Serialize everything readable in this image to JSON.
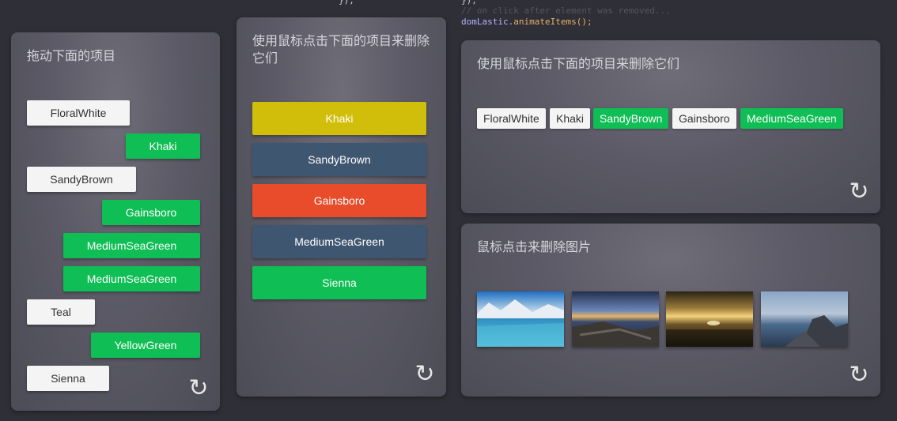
{
  "code": {
    "line_top": "});",
    "line_top_left": "});",
    "line_comment": "// on click after element was removed...",
    "line_call_obj": "domLastic.",
    "line_call_method": "animateItems();"
  },
  "panel1": {
    "title": "拖动下面的项目",
    "items": [
      "FloralWhite",
      "Khaki",
      "SandyBrown",
      "Gainsboro",
      "MediumSeaGreen",
      "MediumSeaGreen",
      "Teal",
      "YellowGreen",
      "Sienna"
    ]
  },
  "panel2": {
    "title": "使用鼠标点击下面的项目来删除它们",
    "items": [
      "Khaki",
      "SandyBrown",
      "Gainsboro",
      "MediumSeaGreen",
      "Sienna"
    ],
    "colors": [
      "#d1be0a",
      "#3f5670",
      "#e84c2b",
      "#3f5670",
      "#0fbe54"
    ]
  },
  "panel3": {
    "title": "使用鼠标点击下面的项目来删除它们",
    "tags": [
      "FloralWhite",
      "Khaki",
      "SandyBrown",
      "Gainsboro",
      "MediumSeaGreen"
    ]
  },
  "panel4": {
    "title": "鼠标点击来删除图片"
  },
  "icons": {
    "refresh": "refresh-icon"
  }
}
